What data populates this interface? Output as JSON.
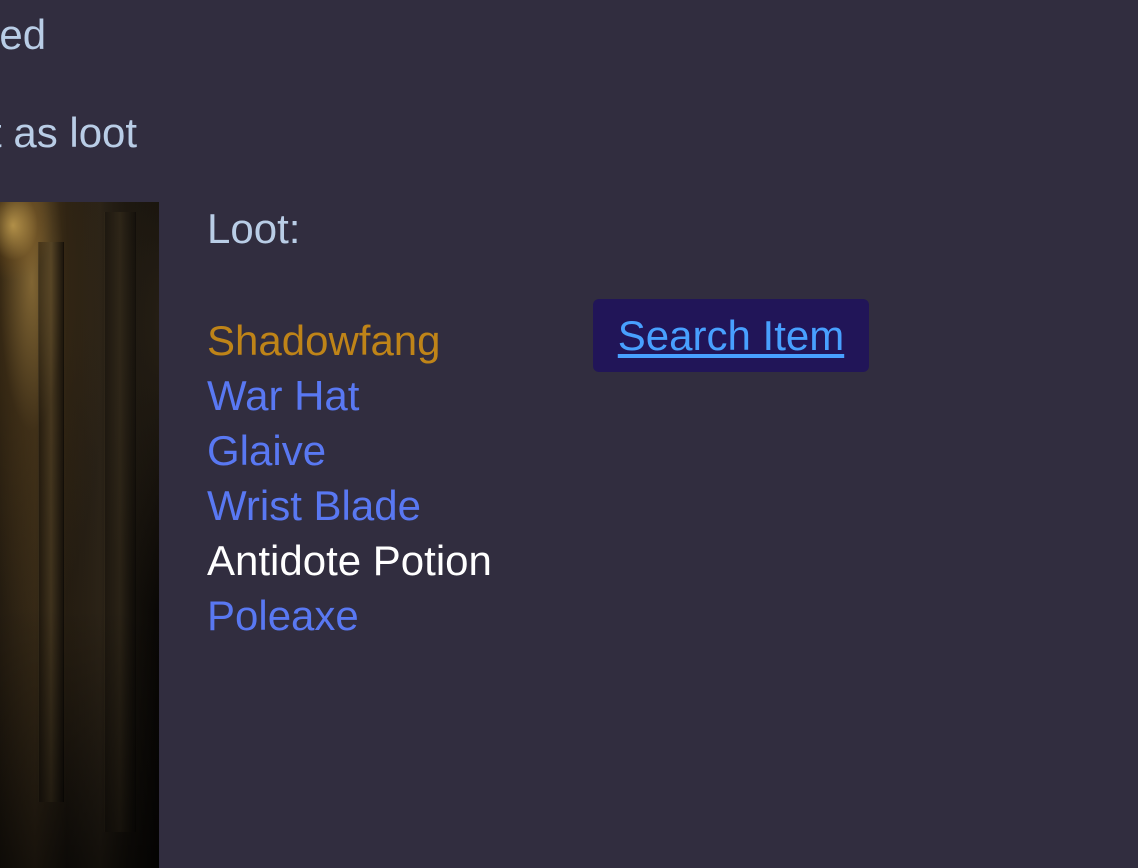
{
  "page": {
    "intro_line_1": "eed",
    "intro_line_2": "t as loot"
  },
  "loot": {
    "heading": "Loot:",
    "items": [
      {
        "name": "Shadowfang",
        "color": "#bf8418"
      },
      {
        "name": "War Hat",
        "color": "#5978f2"
      },
      {
        "name": "Glaive",
        "color": "#5978f2"
      },
      {
        "name": "Wrist Blade",
        "color": "#5978f2"
      },
      {
        "name": "Antidote Potion",
        "color": "#ffffff"
      },
      {
        "name": "Poleaxe",
        "color": "#5978f2"
      }
    ]
  },
  "actions": {
    "search_button_label": "Search Item"
  },
  "colors": {
    "background": "#312d3f",
    "text": "#b9cde6",
    "button_background": "#211558",
    "button_text": "#48a0ff"
  },
  "icons": {
    "monster_image": "monster-art-icon"
  }
}
